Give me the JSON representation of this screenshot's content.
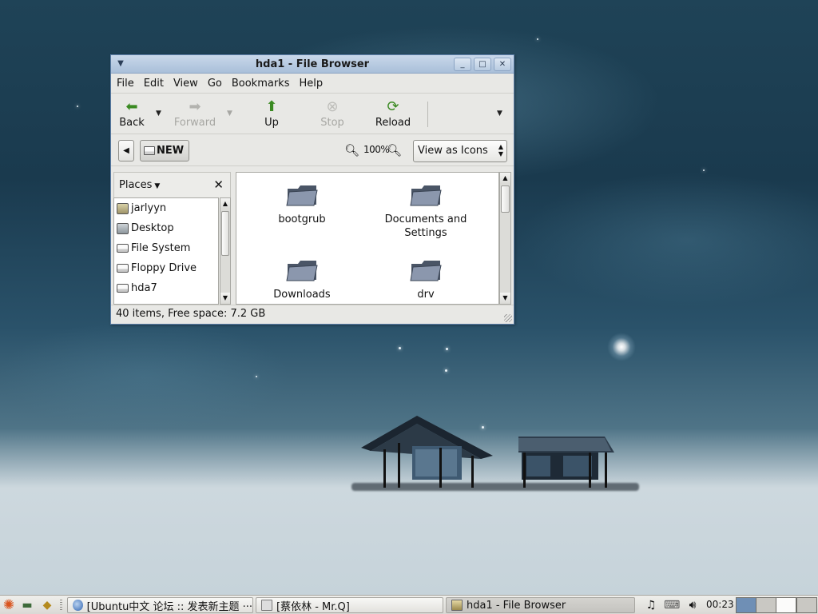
{
  "window": {
    "title": "hda1 - File Browser",
    "menu": [
      "File",
      "Edit",
      "View",
      "Go",
      "Bookmarks",
      "Help"
    ],
    "toolbar": {
      "back": "Back",
      "forward": "Forward",
      "up": "Up",
      "stop": "Stop",
      "reload": "Reload"
    },
    "location": {
      "current": "NEW",
      "zoom": "100%",
      "view_mode": "View as Icons"
    },
    "places": {
      "label": "Places",
      "items": [
        {
          "label": "jarlyyn",
          "icon": "home-folder-icon"
        },
        {
          "label": "Desktop",
          "icon": "desktop-icon"
        },
        {
          "label": "File System",
          "icon": "drive-icon"
        },
        {
          "label": "Floppy Drive",
          "icon": "drive-icon"
        },
        {
          "label": "hda7",
          "icon": "drive-icon"
        }
      ]
    },
    "files": [
      {
        "name": "bootgrub"
      },
      {
        "name": "Documents and Settings"
      },
      {
        "name": "Downloads"
      },
      {
        "name": "drv"
      }
    ],
    "status": "40 items, Free space: 7.2 GB"
  },
  "taskbar": {
    "tasks": [
      {
        "label": "[Ubuntu中文 论坛 :: 发表新主题 ···"
      },
      {
        "label": "[蔡依林 - Mr.Q]"
      },
      {
        "label": "hda1 - File Browser"
      }
    ],
    "clock": "00:23"
  }
}
